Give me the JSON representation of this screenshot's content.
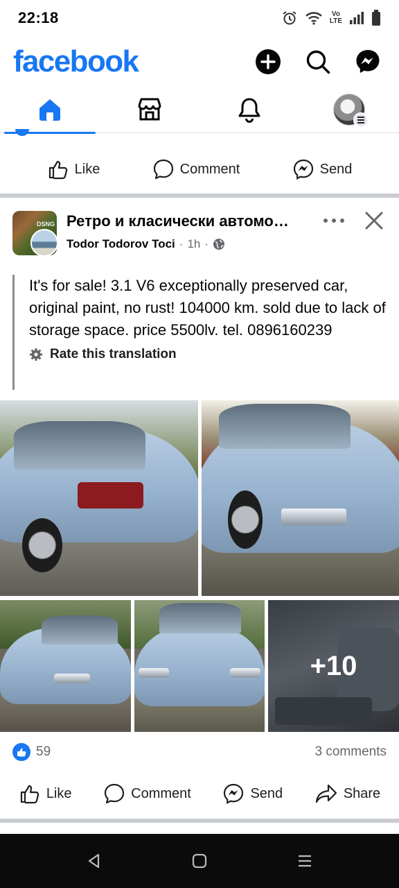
{
  "status_bar": {
    "time": "22:18",
    "icons": [
      "alarm-icon",
      "wifi-icon",
      "volte-icon",
      "signal-icon",
      "battery-icon"
    ],
    "volte_top": "Vo",
    "volte_bottom": "LTE"
  },
  "header": {
    "logo": "facebook",
    "brand_color": "#1877f2",
    "buttons": [
      "create-plus-icon",
      "search-icon",
      "messenger-icon"
    ]
  },
  "tabs": [
    {
      "name": "home",
      "icon": "home-icon",
      "active": true
    },
    {
      "name": "marketplace",
      "icon": "marketplace-icon",
      "active": false
    },
    {
      "name": "notifications",
      "icon": "bell-icon",
      "active": false
    },
    {
      "name": "profile-menu",
      "icon": "avatar",
      "active": false
    }
  ],
  "prev_actions": {
    "like": "Like",
    "comment": "Comment",
    "send": "Send"
  },
  "post": {
    "group_name": "Ретро и класически автомобили",
    "group_logo_text": "DSNG",
    "author": "Todor Todorov Toci",
    "time": "1h",
    "audience_icon": "globe-icon",
    "text": "It's for sale! 3.1 V6 exceptionally preserved car, original paint, no rust! 104000 km. sold due to lack of storage space. price 5500lv. tel. 0896160239",
    "rate_translation": "Rate this translation",
    "photos_more": "+10",
    "reactions": {
      "count": "59",
      "comments": "3 comments"
    },
    "actions": {
      "like": "Like",
      "comment": "Comment",
      "send": "Send",
      "share": "Share"
    }
  },
  "nav": [
    "back-icon",
    "home-square-icon",
    "recents-menu-icon"
  ]
}
